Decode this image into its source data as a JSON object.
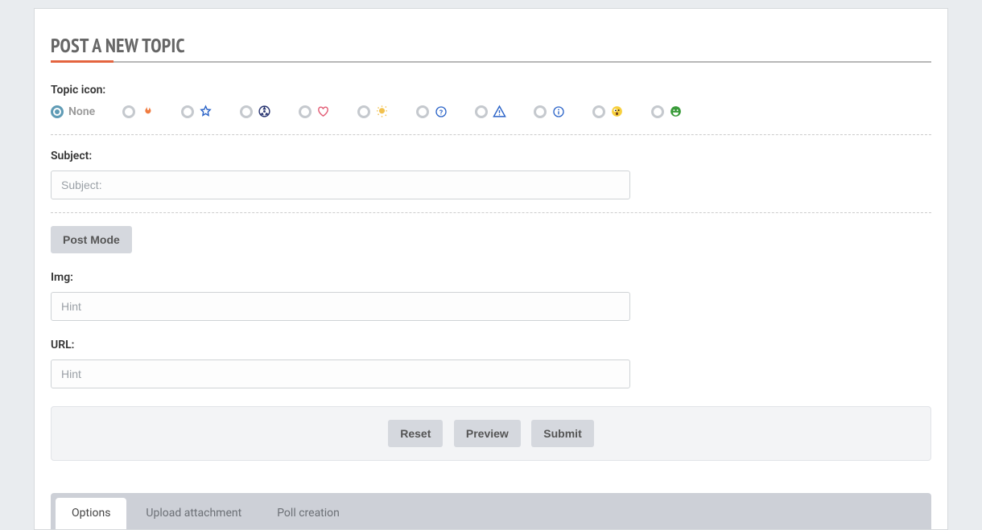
{
  "title": "POST A NEW TOPIC",
  "topic_icon": {
    "label": "Topic icon:",
    "none_label": "None",
    "selected_index": 0,
    "icons": [
      "fire-icon",
      "star-icon",
      "radioactive-icon",
      "heart-icon",
      "lightbulb-icon",
      "question-icon",
      "warning-icon",
      "info-icon",
      "surprised-face-icon",
      "grin-face-icon"
    ]
  },
  "subject": {
    "label": "Subject:",
    "placeholder": "Subject:",
    "value": ""
  },
  "post_mode_label": "Post Mode",
  "img": {
    "label": "Img:",
    "placeholder": "Hint",
    "value": ""
  },
  "url": {
    "label": "URL:",
    "placeholder": "Hint",
    "value": ""
  },
  "actions": {
    "reset": "Reset",
    "preview": "Preview",
    "submit": "Submit"
  },
  "tabs": {
    "items": [
      "Options",
      "Upload attachment",
      "Poll creation"
    ],
    "active_index": 0
  }
}
